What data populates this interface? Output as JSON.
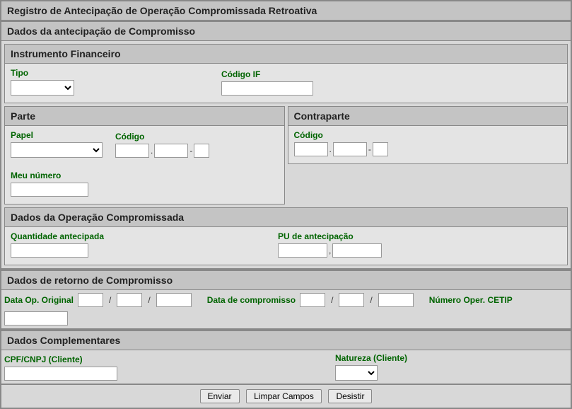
{
  "page_title": "Registro de Antecipação de Operação Compromissada Retroativa",
  "section_dados_antecipacao_title": "Dados da antecipação de Compromisso",
  "instrumento": {
    "title": "Instrumento Financeiro",
    "tipo_label": "Tipo",
    "tipo_value": "",
    "codigo_if_label": "Código IF",
    "codigo_if_value": ""
  },
  "parte": {
    "title": "Parte",
    "papel_label": "Papel",
    "papel_value": "",
    "codigo_label": "Código",
    "codigo_a": "",
    "codigo_b": "",
    "codigo_c": "",
    "meu_numero_label": "Meu número",
    "meu_numero_value": ""
  },
  "contraparte": {
    "title": "Contraparte",
    "codigo_label": "Código",
    "codigo_a": "",
    "codigo_b": "",
    "codigo_c": ""
  },
  "dados_operacao": {
    "title": "Dados da Operação Compromissada",
    "quantidade_label": "Quantidade antecipada",
    "quantidade_value": "",
    "pu_label": "PU de antecipação",
    "pu_int": "",
    "pu_dec": ""
  },
  "dados_retorno": {
    "title": "Dados de retorno de Compromisso",
    "data_op_original_label": "Data Op. Original",
    "data_op_original_d": "",
    "data_op_original_m": "",
    "data_op_original_y": "",
    "data_compromisso_label": "Data de compromisso",
    "data_compromisso_d": "",
    "data_compromisso_m": "",
    "data_compromisso_y": "",
    "numero_cetip_label": "Número Oper. CETIP",
    "numero_cetip_value": ""
  },
  "dados_complementares": {
    "title": "Dados Complementares",
    "cpf_cnpj_label": "CPF/CNPJ (Cliente)",
    "cpf_cnpj_value": "",
    "natureza_label": "Natureza (Cliente)",
    "natureza_value": ""
  },
  "buttons": {
    "enviar": "Enviar",
    "limpar": "Limpar Campos",
    "desistir": "Desistir"
  }
}
